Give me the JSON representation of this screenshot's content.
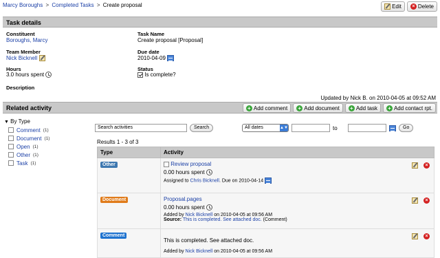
{
  "breadcrumb": {
    "items": [
      "Marcy Boroughs",
      "Completed Tasks"
    ],
    "current": "Create proposal",
    "sep": ">"
  },
  "toolbar": {
    "edit_label": "Edit",
    "delete_label": "Delete"
  },
  "task_details": {
    "header": "Task details",
    "constituent_label": "Constituent",
    "constituent_value": "Boroughs, Marcy",
    "team_member_label": "Team Member",
    "team_member_value": "Nick Bicknell",
    "hours_label": "Hours",
    "hours_value": "3.0 hours spent",
    "description_label": "Description",
    "task_name_label": "Task Name",
    "task_name_value": "Create proposal [Proposal]",
    "due_date_label": "Due date",
    "due_date_value": "2010-04-09",
    "status_label": "Status",
    "status_value": "Is complete?",
    "status_checked": true,
    "updated_by": "Updated by Nick B. on 2010-04-05 at 09:52 AM"
  },
  "related_activity": {
    "header": "Related activity",
    "buttons": [
      "Add comment",
      "Add document",
      "Add task",
      "Add contact rpt."
    ]
  },
  "sidebar": {
    "heading": "By Type",
    "items": [
      {
        "label": "Comment",
        "count": "(1)"
      },
      {
        "label": "Document",
        "count": "(1)"
      },
      {
        "label": "Open",
        "count": "(1)"
      },
      {
        "label": "Other",
        "count": "(1)"
      },
      {
        "label": "Task",
        "count": "(1)"
      }
    ]
  },
  "search": {
    "placeholder": "Search activities",
    "button": "Search",
    "date_select": "All dates",
    "to_label": "to",
    "go_label": "Go"
  },
  "results": {
    "summary": "Results 1 - 3 of 3",
    "col_type": "Type",
    "col_activity": "Activity",
    "rows": [
      {
        "type": "Other",
        "type_color": "#3e78b0",
        "title": "Review proposal",
        "hours": "0.00 hours spent",
        "assigned_prefix": "Assigned to",
        "assigned_to": "Chris Bicknell",
        "due": ". Due on 2010-04-14"
      },
      {
        "type": "Document",
        "type_color": "#e07b1a",
        "title": "Proposal.pages",
        "hours": "0.00 hours spent",
        "added_prefix": "Added by",
        "added_by": "Nick Bicknell",
        "added_on": "on 2010-04-05 at 09:56 AM",
        "source_label": "Source:",
        "source_link": "This is completed. See attached doc.",
        "source_suffix": "(Comment)"
      },
      {
        "type": "Comment",
        "type_color": "#1f73cf",
        "text": "This is completed. See attached doc.",
        "added_prefix": "Added by",
        "added_by": "Nick Bicknell",
        "added_on": "on 2010-04-05 at 09:56 AM"
      }
    ]
  }
}
